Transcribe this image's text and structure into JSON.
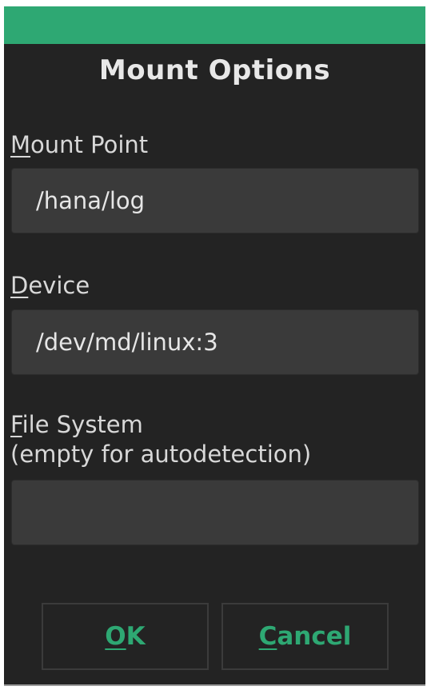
{
  "dialog": {
    "title": "Mount Options",
    "accent_color": "#2ea873",
    "background_color": "#232323"
  },
  "mount_point": {
    "label_hotkey": "M",
    "label_rest": "ount Point",
    "value": "/hana/log"
  },
  "device": {
    "label_hotkey": "D",
    "label_rest": "evice",
    "value": "/dev/md/linux:3"
  },
  "file_system": {
    "label_hotkey": "F",
    "label_rest": "ile System",
    "label_line2": "(empty for autodetection)",
    "value": ""
  },
  "buttons": {
    "ok_hotkey": "O",
    "ok_rest": "K",
    "cancel_hotkey": "C",
    "cancel_rest": "ancel"
  }
}
